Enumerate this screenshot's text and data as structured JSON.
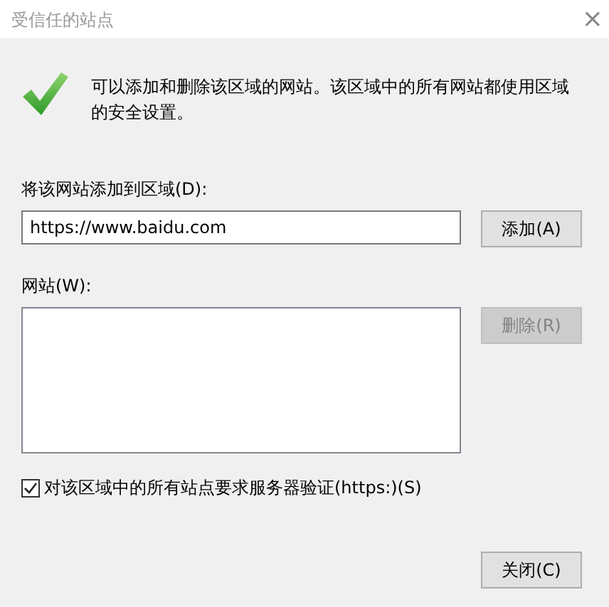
{
  "window": {
    "title": "受信任的站点",
    "close": "×"
  },
  "info": {
    "text": "可以添加和删除该区域的网站。该区域中的所有网站都使用区域的安全设置。"
  },
  "add_field": {
    "label": "将该网站添加到区域(D):",
    "value": "https://www.baidu.com"
  },
  "add_button": {
    "label": "添加(A)",
    "disabled": false
  },
  "sites": {
    "label": "网站(W):"
  },
  "remove_button": {
    "label": "删除(R)",
    "disabled": true
  },
  "require_https": {
    "label": "对该区域中的所有站点要求服务器验证(https:)(S)",
    "checked": true
  },
  "close_button": {
    "label": "关闭(C)",
    "disabled": false
  }
}
